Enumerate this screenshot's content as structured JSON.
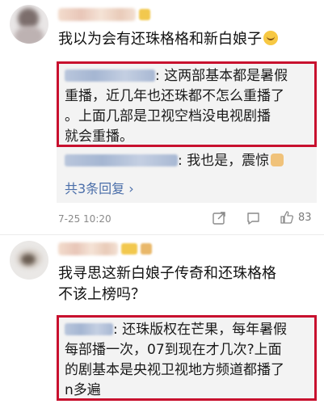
{
  "comments": [
    {
      "text": "我以为会有还珠格格和新白娘子",
      "replies": {
        "first_line1": ": 这两部基本都是暑假",
        "first_line2": "重播，近几年也还珠都不怎么重播了",
        "first_line3": "。上面几部是卫视空档没电视剧播",
        "first_line4": "就会重播。",
        "second": ": 我也是，震惊",
        "more_label": "共3条回复 ›"
      },
      "time": "7-25 10:20",
      "likes": "83"
    },
    {
      "text_line1": "我寻思这新白娘子传奇和还珠格格",
      "text_line2": "不该上榜吗？",
      "reply_line1": ": 还珠版权在芒果，每年暑假",
      "reply_line2": "每部播一次，07到现在才几次?上面",
      "reply_line3": "的剧基本是央视卫视地方频道都播了",
      "reply_line4": "n多遍"
    }
  ],
  "icons": [
    "share-icon",
    "comment-icon",
    "like-icon"
  ],
  "colors": {
    "highlight_border": "#c8102e",
    "link_blue": "#4a6ea9",
    "reply_bg": "#f3f3f3"
  }
}
